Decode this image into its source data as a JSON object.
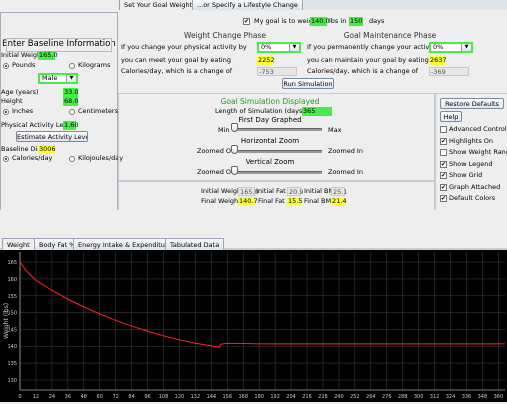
{
  "top_tabs": [
    "Set Your Goal Weight",
    "...or Specify a Lifestyle Change"
  ],
  "goal": {
    "prefix": "My goal is to weigh",
    "weight": "140.0",
    "mid": "lbs in",
    "days": "150",
    "suffix": "days"
  },
  "weight_change": {
    "title": "Weight Change Phase",
    "activity_q": "If you change your physical activity by",
    "activity_val": "0%",
    "eat_label": "you can meet your goal by eating",
    "eat_val": "2252",
    "cal_label": "Calories/day, which is a change of",
    "cal_val": "-753"
  },
  "maintenance": {
    "title": "Goal Maintenance Phase",
    "activity_q": "If you permanently change your activity by",
    "activity_val": "0%",
    "eat_label": "you can maintain your goal by eating",
    "eat_val": "2637",
    "cal_label": "Calories/day, which is a change of",
    "cal_val": "-369"
  },
  "run_button": "Run Simulation",
  "baseline": {
    "title": "Enter Baseline Information",
    "initial_weight_label": "Initial Weight",
    "initial_weight": "165.0",
    "pounds": "Pounds",
    "kilograms": "Kilograms",
    "sex": "Male",
    "age_label": "Age (years)",
    "age": "33.0",
    "height_label": "Height",
    "height": "68.0",
    "inches": "Inches",
    "centimeters": "Centimeters",
    "pal_label": "Physical Activity Level",
    "pal": "1.60",
    "estimate_btn": "Estimate Activity Level",
    "diet_label": "Baseline Diet",
    "diet": "3006",
    "cal_unit": "Calories/day",
    "kj_unit": "Kilojoules/day"
  },
  "simulation": {
    "title": "Goal Simulation Displayed",
    "length_label": "Length of Simulation (days)",
    "length": "365",
    "first_day": "First Day Graphed",
    "min": "Min",
    "max": "Max",
    "hzoom": "Horizontal Zoom",
    "zoomed_out": "Zoomed Out",
    "zoomed_in": "Zoomed In",
    "vzoom": "Vertical Zoom",
    "zoomed_out2": "Zoomed Out",
    "zoomed_in2": "Zoomed In"
  },
  "summary": {
    "iw_label": "Initial Weight",
    "iw": "165.0",
    "if_label": "Initial Fat %",
    "if": "20.9",
    "ib_label": "Initial BMI",
    "ib": "25.1",
    "fw_label": "Final Weight",
    "fw": "140.7",
    "ff_label": "Final Fat %",
    "ff": "15.5",
    "fb_label": "Final BMI",
    "fb": "21.4"
  },
  "right_panel": {
    "restore": "Restore Defaults",
    "help": "Help",
    "options": [
      {
        "label": "Advanced Controls",
        "checked": false
      },
      {
        "label": "Highlights On",
        "checked": true
      },
      {
        "label": "Show Weight Range",
        "checked": false
      },
      {
        "label": "Show Legend",
        "checked": true
      },
      {
        "label": "Show Grid",
        "checked": true
      },
      {
        "label": "Graph Attached",
        "checked": true
      },
      {
        "label": "Default Colors",
        "checked": true
      }
    ]
  },
  "graph_tabs": [
    "Weight",
    "Body Fat %",
    "Energy Intake & Expenditure",
    "Tabulated Data"
  ],
  "chart_data": {
    "type": "line",
    "ylabel": "Weight (lbs)",
    "ylim": [
      127,
      168
    ],
    "xlim": [
      0,
      365
    ],
    "yticks": [
      130,
      135,
      140,
      145,
      150,
      155,
      160,
      165
    ],
    "xticks": [
      0,
      12,
      24,
      36,
      48,
      60,
      72,
      84,
      96,
      108,
      120,
      132,
      144,
      156,
      168,
      180,
      192,
      204,
      216,
      228,
      240,
      252,
      264,
      276,
      288,
      300,
      312,
      324,
      336,
      348,
      360
    ],
    "series": [
      {
        "color": "#ff2020",
        "x": [
          0,
          5,
          12,
          24,
          36,
          48,
          60,
          72,
          84,
          96,
          108,
          120,
          132,
          144,
          150,
          151,
          156,
          168,
          180,
          200,
          240,
          300,
          365
        ],
        "y": [
          165.0,
          162.3,
          159.6,
          156.6,
          154.0,
          151.7,
          149.6,
          147.7,
          146.0,
          144.5,
          143.1,
          141.9,
          140.9,
          140.1,
          139.7,
          140.6,
          140.9,
          140.8,
          140.7,
          140.7,
          140.7,
          140.7,
          140.7
        ]
      }
    ]
  }
}
